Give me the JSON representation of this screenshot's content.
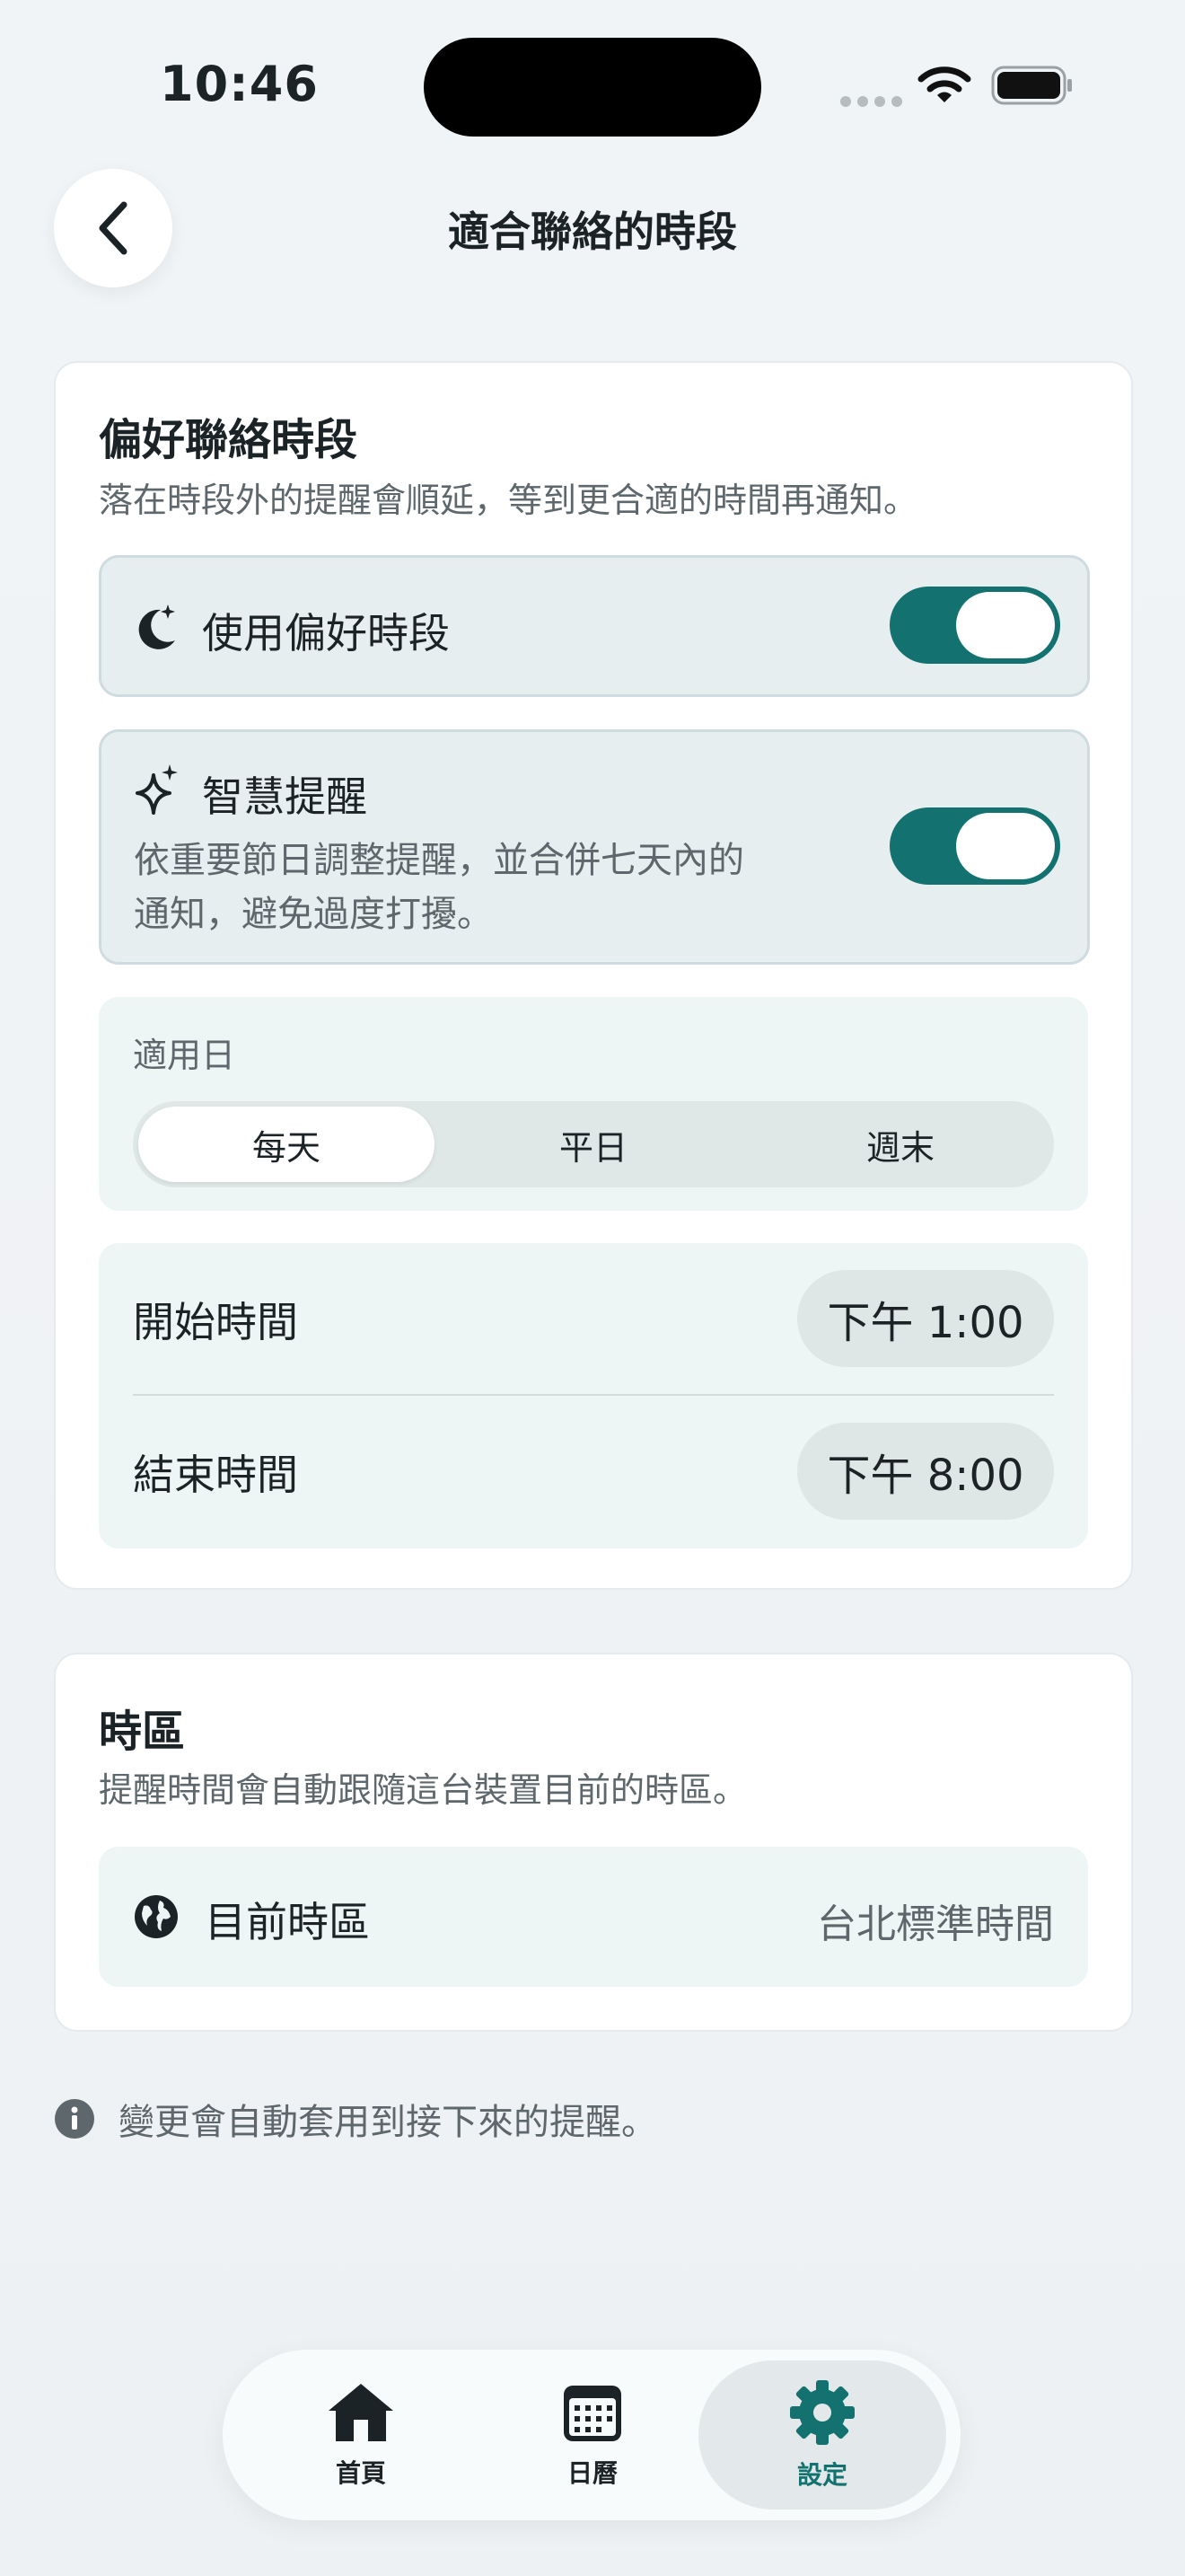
{
  "status_bar": {
    "time": "10:46"
  },
  "header": {
    "title": "適合聯絡的時段"
  },
  "preferred": {
    "title": "偏好聯絡時段",
    "subtitle": "落在時段外的提醒會順延，等到更合適的時間再通知。",
    "use_preferred": {
      "label": "使用偏好時段",
      "on": true
    },
    "smart": {
      "label": "智慧提醒",
      "desc_line1": "依重要節日調整提醒，並合併七天內的",
      "desc_line2": "通知，避免過度打擾。",
      "on": true
    },
    "days": {
      "label": "適用日",
      "options": [
        "每天",
        "平日",
        "週末"
      ],
      "selected": "每天"
    },
    "start": {
      "label": "開始時間",
      "value": "下午 1:00"
    },
    "end": {
      "label": "結束時間",
      "value": "下午 8:00"
    }
  },
  "timezone": {
    "title": "時區",
    "subtitle": "提醒時間會自動跟隨這台裝置目前的時區。",
    "current_label": "目前時區",
    "current_value": "台北標準時間"
  },
  "note": "變更會自動套用到接下來的提醒。",
  "tabbar": {
    "items": [
      {
        "label": "首頁",
        "icon": "home-icon"
      },
      {
        "label": "日曆",
        "icon": "calendar-icon"
      },
      {
        "label": "設定",
        "icon": "gear-icon"
      }
    ],
    "active": "設定"
  },
  "colors": {
    "accent": "#137270",
    "card": "#ffffff",
    "background": "#eef1f4"
  }
}
